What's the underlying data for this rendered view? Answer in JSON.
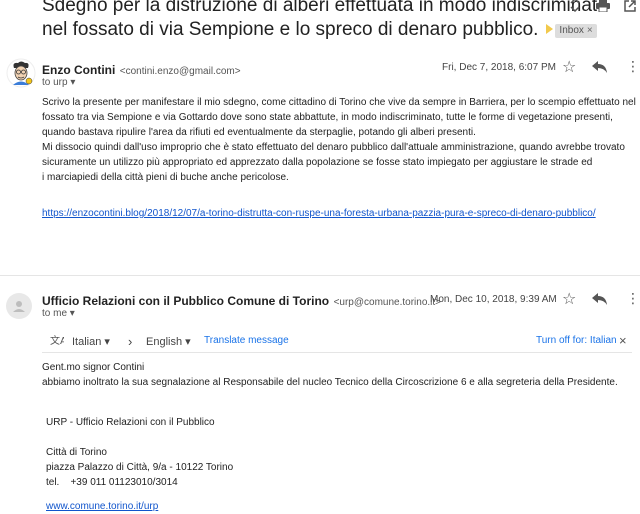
{
  "thread": {
    "subject_line1": "Sdegno per la distruzione di alberi effettuata in modo indiscriminato",
    "subject_line2": "nel fossato di via Sempione e lo spreco di denaro pubblico.",
    "label": "Inbox",
    "label_close": "×"
  },
  "toolbar": {
    "expand_icon": "⇅",
    "print_icon": "🖶",
    "newwindow_icon": "⧉"
  },
  "message1": {
    "sender_name": "Enzo Contini",
    "sender_email": "<contini.enzo@gmail.com>",
    "to": "to urp",
    "date": "Fri, Dec 7, 2018, 6:07 PM",
    "body_lines": [
      "Scrivo la presente per manifestare il mio sdegno, come cittadino di Torino che vive da sempre in Barriera, per lo scempio effettuato nel",
      "fossato tra via Sempione e via Gottardo dove sono state abbattute, in modo indiscriminato, tutte le forme di vegetazione presenti,",
      "quando bastava ripulire l'area da rifiuti ed eventualmente da sterpaglie, potando gli alberi presenti.",
      "Mi dissocio quindi dall'uso improprio che è stato effettuato del denaro pubblico dall'attuale amministrazione, quando avrebbe trovato",
      "sicuramente un utilizzo più appropriato ed apprezzato dalla popolazione se fosse stato impiegato per aggiustare le  strade ed",
      "i marciapiedi della città pieni di buche anche pericolose."
    ],
    "link": "https://enzocontini.blog/2018/12/07/a-torino-distrutta-con-ruspe-una-foresta-urbana-pazzia-pura-e-spreco-di-denaro-pubblico/"
  },
  "message2": {
    "sender_name": "Ufficio Relazioni con il Pubblico Comune di Torino",
    "sender_email": "<urp@comune.torino.it>",
    "to": "to me",
    "date": "Mon, Dec 10, 2018, 9:39 AM",
    "translate": {
      "source_lang": "Italian",
      "arrow": "›",
      "target_lang": "English",
      "translate_label": "Translate message",
      "turn_off_label": "Turn off for: Italian",
      "close": "×"
    },
    "greeting": "Gent.mo signor Contini",
    "body": "abbiamo inoltrato la sua segnalazione al Responsabile del nucleo Tecnico della Circoscrizione 6 e alla segreteria della Presidente.",
    "signature": {
      "org": "URP - Ufficio Relazioni con il Pubblico",
      "city": "Città di Torino",
      "address": "piazza Palazzo di Città, 9/a - 10122 Torino",
      "tel": "tel.    +39 011 01123010/3014",
      "website": "www.comune.torino.it/urp"
    }
  },
  "colors": {
    "link": "#1155cc",
    "accent": "#1a73e8",
    "label_bg": "#dddddd"
  }
}
